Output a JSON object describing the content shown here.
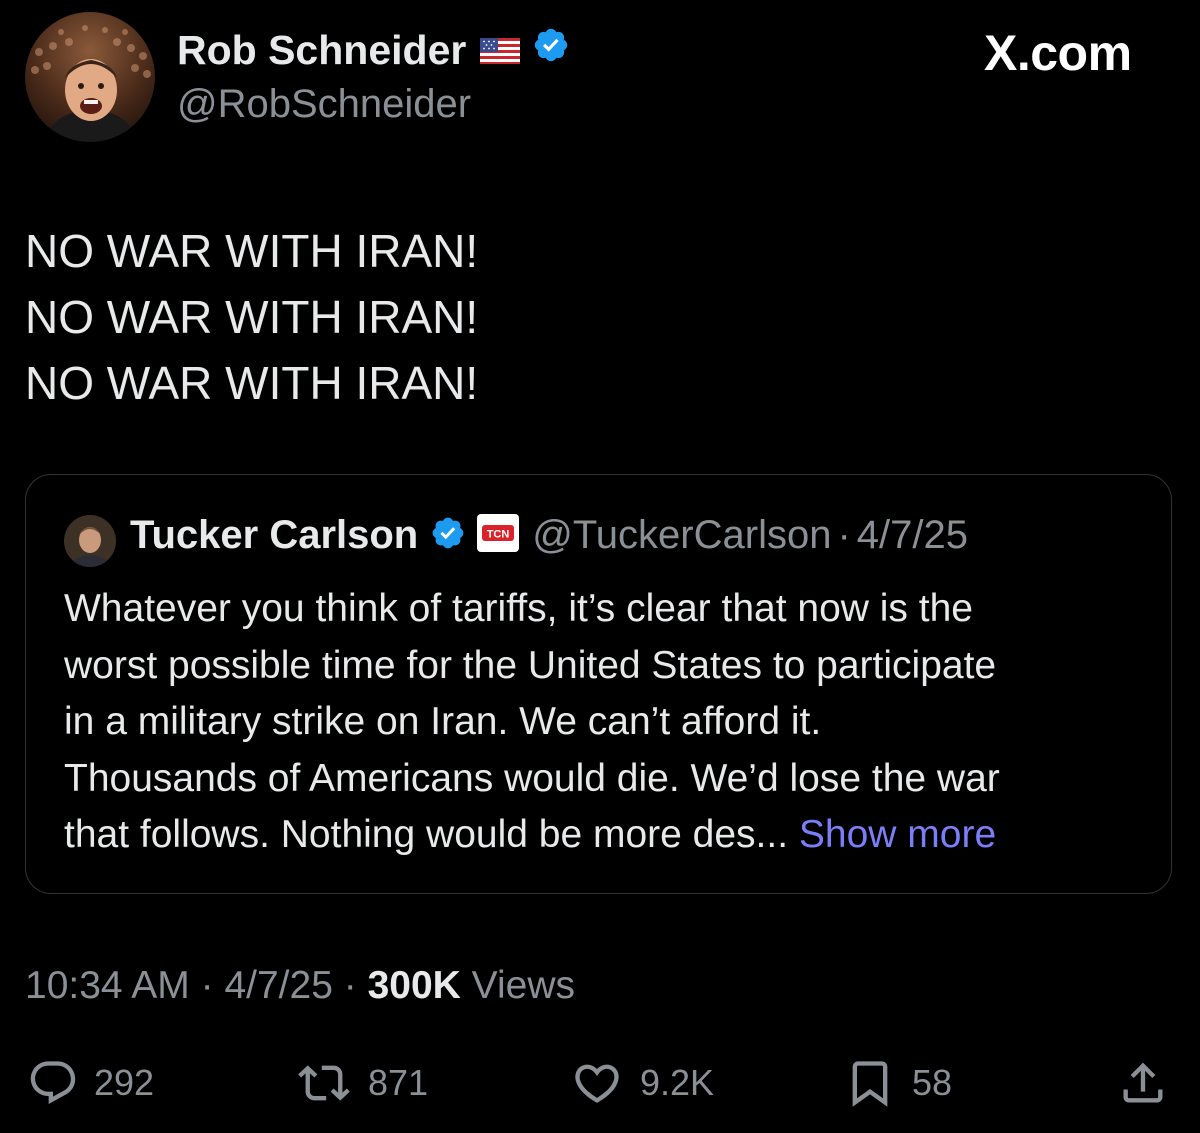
{
  "author": {
    "display_name": "Rob Schneider",
    "handle": "@RobSchneider",
    "flag_icon": "us-flag-icon",
    "verified_color": "#1d9bf0"
  },
  "brand": "X.com",
  "tweet": {
    "lines": [
      "NO WAR WITH IRAN!",
      "NO WAR WITH IRAN!",
      "NO WAR WITH IRAN!"
    ]
  },
  "quote": {
    "display_name": "Tucker Carlson",
    "affiliate_badge": "TCN",
    "handle": "@TuckerCarlson",
    "separator": "·",
    "date": "4/7/25",
    "lines": [
      "Whatever you think of tariffs, it’s clear that now is the",
      "worst possible time for the United States to participate",
      "in a military strike on Iran. We can’t afford it.",
      "Thousands of Americans would die. We’d lose the war",
      "that follows. Nothing would be more des..."
    ],
    "show_more": "Show more",
    "show_more_color": "#7b7ff7"
  },
  "meta": {
    "time": "10:34 AM",
    "sep1": "·",
    "date": "4/7/25",
    "sep2": "·",
    "views_count": "300K",
    "views_label": "Views"
  },
  "actions": {
    "replies": "292",
    "reposts": "871",
    "likes": "9.2K",
    "bookmarks": "58"
  }
}
